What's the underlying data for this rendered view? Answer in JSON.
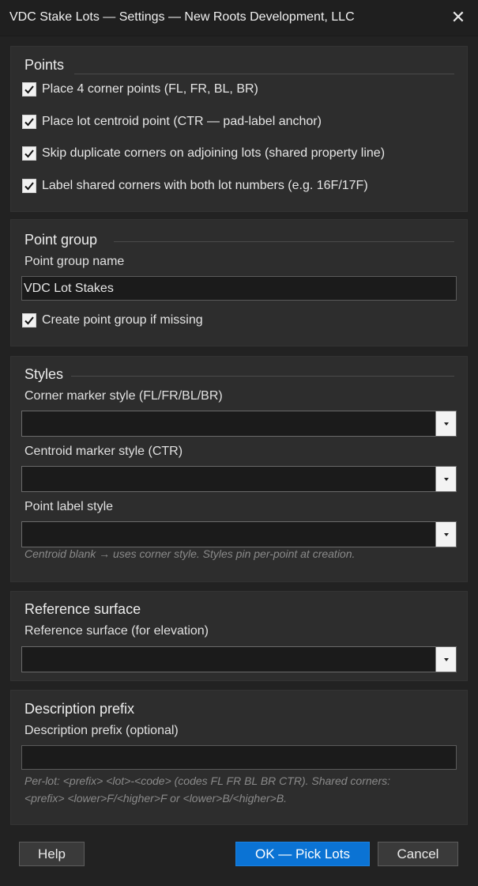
{
  "window": {
    "title": "VDC Stake Lots — Settings — New Roots Development, LLC",
    "close_glyph": "✕"
  },
  "points": {
    "heading": "Points",
    "options": [
      {
        "label": "Place 4 corner points (FL, FR, BL, BR)",
        "checked": true
      },
      {
        "label": "Place lot centroid point (CTR — pad-label anchor)",
        "checked": true
      },
      {
        "label": "Skip duplicate corners on adjoining lots (shared property line)",
        "checked": true
      },
      {
        "label": "Label shared corners with both lot numbers (e.g. 16F/17F)",
        "checked": true
      }
    ]
  },
  "point_group": {
    "heading": "Point group",
    "name_label": "Point group name",
    "name_value": "VDC Lot Stakes",
    "create_label": "Create point group if missing",
    "create_checked": true
  },
  "styles": {
    "heading": "Styles",
    "corner_label": "Corner marker style (FL/FR/BL/BR)",
    "corner_value": "",
    "centroid_label": "Centroid marker style (CTR)",
    "centroid_value": "",
    "point_label_label": "Point label style",
    "point_label_value": "",
    "hint": "Centroid blank → uses corner style. Styles pin per-point at creation."
  },
  "reference_surface": {
    "heading": "Reference surface",
    "label": "Reference surface (for elevation)",
    "value": ""
  },
  "description_prefix": {
    "heading": "Description prefix",
    "label": "Description prefix (optional)",
    "value": "",
    "hint_line1": "Per-lot: <prefix> <lot>-<code> (codes FL FR BL BR CTR). Shared corners:",
    "hint_line2": "<prefix> <lower>F/<higher>F or <lower>B/<higher>B."
  },
  "buttons": {
    "help": "Help",
    "ok": "OK — Pick Lots",
    "cancel": "Cancel"
  },
  "colors": {
    "primary_button": "#0b73d4",
    "background": "#222222",
    "panel": "#2d2d2d"
  }
}
